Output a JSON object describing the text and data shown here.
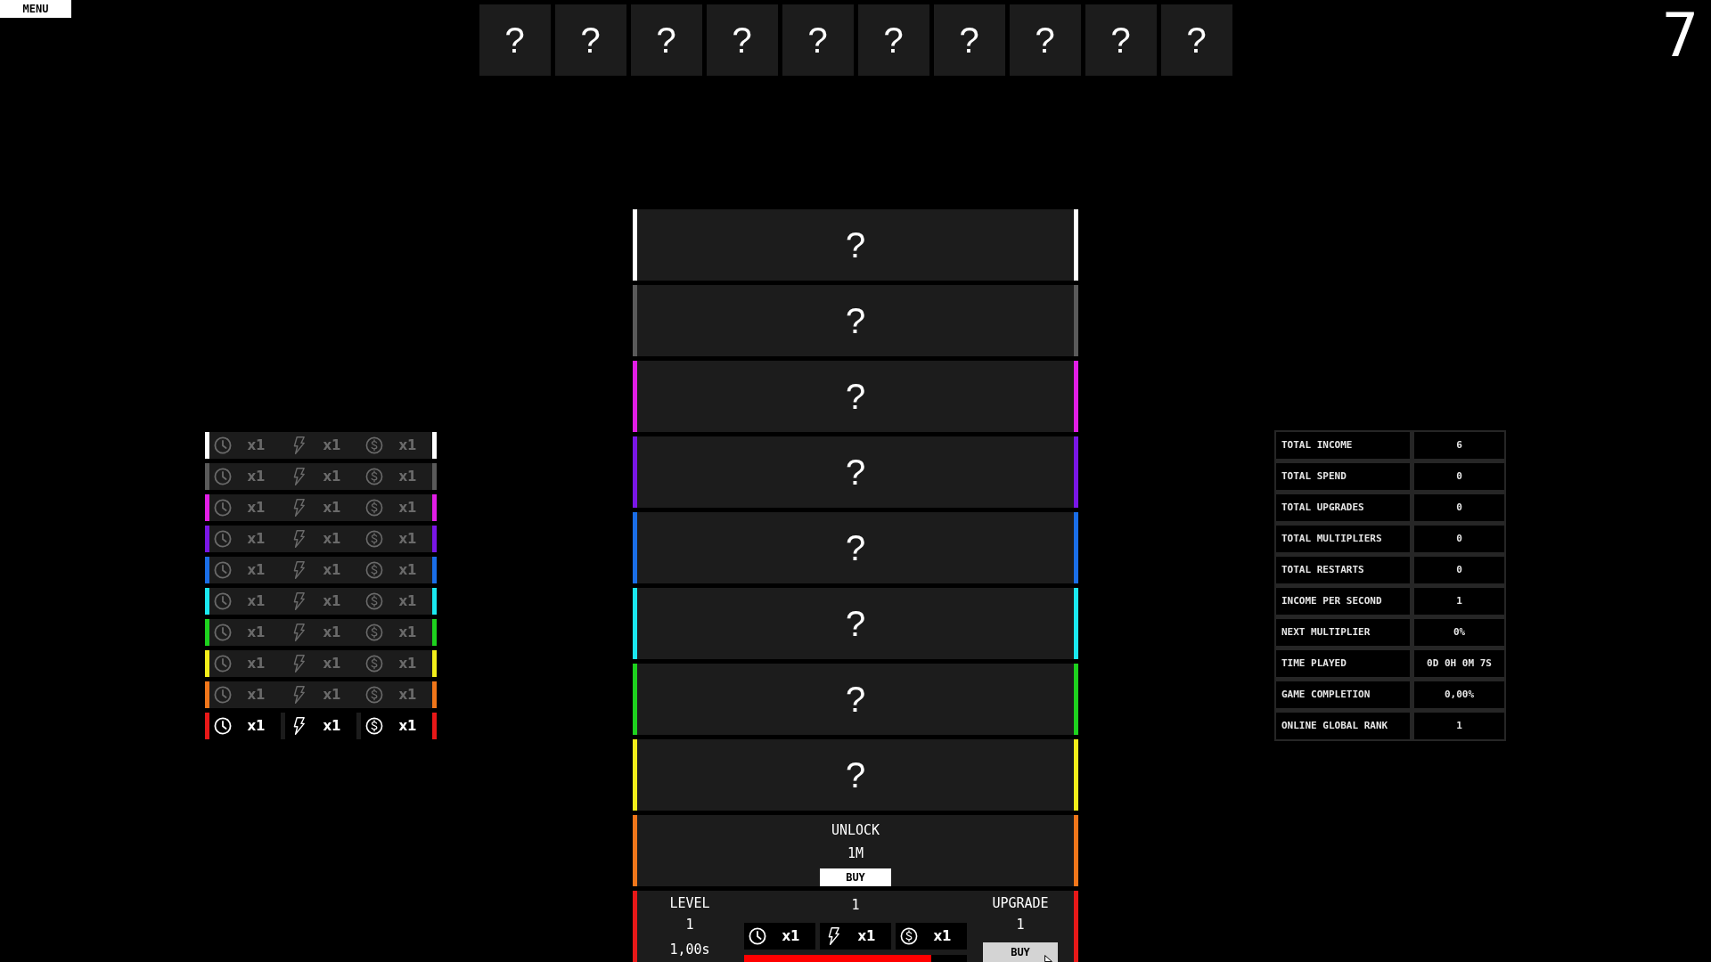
{
  "menu_button": "MENU",
  "slots": [
    "?",
    "?",
    "?",
    "?",
    "?",
    "?",
    "?",
    "?",
    "?",
    "?"
  ],
  "counter": "7",
  "multiplier_rows": [
    {
      "color": "#ffffff",
      "unlocked": false,
      "multipliers": [
        {
          "kind": "time",
          "value": "x1"
        },
        {
          "kind": "speed",
          "value": "x1"
        },
        {
          "kind": "money",
          "value": "x1"
        }
      ]
    },
    {
      "color": "#5a5a5a",
      "unlocked": false,
      "multipliers": [
        {
          "kind": "time",
          "value": "x1"
        },
        {
          "kind": "speed",
          "value": "x1"
        },
        {
          "kind": "money",
          "value": "x1"
        }
      ]
    },
    {
      "color": "#e21ee6",
      "unlocked": false,
      "multipliers": [
        {
          "kind": "time",
          "value": "x1"
        },
        {
          "kind": "speed",
          "value": "x1"
        },
        {
          "kind": "money",
          "value": "x1"
        }
      ]
    },
    {
      "color": "#7a16e6",
      "unlocked": false,
      "multipliers": [
        {
          "kind": "time",
          "value": "x1"
        },
        {
          "kind": "speed",
          "value": "x1"
        },
        {
          "kind": "money",
          "value": "x1"
        }
      ]
    },
    {
      "color": "#1a6ee8",
      "unlocked": false,
      "multipliers": [
        {
          "kind": "time",
          "value": "x1"
        },
        {
          "kind": "speed",
          "value": "x1"
        },
        {
          "kind": "money",
          "value": "x1"
        }
      ]
    },
    {
      "color": "#1ae8f0",
      "unlocked": false,
      "multipliers": [
        {
          "kind": "time",
          "value": "x1"
        },
        {
          "kind": "speed",
          "value": "x1"
        },
        {
          "kind": "money",
          "value": "x1"
        }
      ]
    },
    {
      "color": "#1ed21e",
      "unlocked": false,
      "multipliers": [
        {
          "kind": "time",
          "value": "x1"
        },
        {
          "kind": "speed",
          "value": "x1"
        },
        {
          "kind": "money",
          "value": "x1"
        }
      ]
    },
    {
      "color": "#f2ee1a",
      "unlocked": false,
      "multipliers": [
        {
          "kind": "time",
          "value": "x1"
        },
        {
          "kind": "speed",
          "value": "x1"
        },
        {
          "kind": "money",
          "value": "x1"
        }
      ]
    },
    {
      "color": "#f0761a",
      "unlocked": false,
      "multipliers": [
        {
          "kind": "time",
          "value": "x1"
        },
        {
          "kind": "speed",
          "value": "x1"
        },
        {
          "kind": "money",
          "value": "x1"
        }
      ]
    },
    {
      "color": "#e81818",
      "unlocked": true,
      "multipliers": [
        {
          "kind": "time",
          "value": "x1"
        },
        {
          "kind": "speed",
          "value": "x1"
        },
        {
          "kind": "money",
          "value": "x1"
        }
      ]
    }
  ],
  "tiers": [
    {
      "kind": "hidden",
      "color": "#ffffff",
      "label": "?"
    },
    {
      "kind": "hidden",
      "color": "#5a5a5a",
      "label": "?"
    },
    {
      "kind": "hidden",
      "color": "#e21ee6",
      "label": "?"
    },
    {
      "kind": "hidden",
      "color": "#7a16e6",
      "label": "?"
    },
    {
      "kind": "hidden",
      "color": "#1a6ee8",
      "label": "?"
    },
    {
      "kind": "hidden",
      "color": "#1ae8f0",
      "label": "?"
    },
    {
      "kind": "hidden",
      "color": "#1ed21e",
      "label": "?"
    },
    {
      "kind": "hidden",
      "color": "#f2ee1a",
      "label": "?"
    },
    {
      "kind": "unlock",
      "color": "#f0761a",
      "title": "UNLOCK",
      "cost": "1M",
      "button": "BUY"
    },
    {
      "kind": "active",
      "color": "#e81818",
      "level_label": "LEVEL",
      "level": "1",
      "cycle_time": "1,00s",
      "count": "1",
      "multipliers": [
        {
          "kind": "time",
          "value": "x1"
        },
        {
          "kind": "speed",
          "value": "x1"
        },
        {
          "kind": "money",
          "value": "x1"
        }
      ],
      "progress": {
        "level": 0.84
      },
      "upgrade_label": "UPGRADE",
      "upgrade_cost": "1",
      "button": "BUY"
    }
  ],
  "stats": [
    {
      "label": "TOTAL INCOME",
      "value": "6"
    },
    {
      "label": "TOTAL SPEND",
      "value": "0"
    },
    {
      "label": "TOTAL UPGRADES",
      "value": "0"
    },
    {
      "label": "TOTAL MULTIPLIERS",
      "value": "0"
    },
    {
      "label": "TOTAL RESTARTS",
      "value": "0"
    },
    {
      "label": "INCOME PER SECOND",
      "value": "1"
    },
    {
      "label": "NEXT MULTIPLIER",
      "value": "0%"
    },
    {
      "label": "TIME PLAYED",
      "value": "0D 0H 0M 7S"
    },
    {
      "label": "GAME COMPLETION",
      "value": "0,00%"
    },
    {
      "label": "ONLINE GLOBAL RANK",
      "value": "1"
    }
  ]
}
